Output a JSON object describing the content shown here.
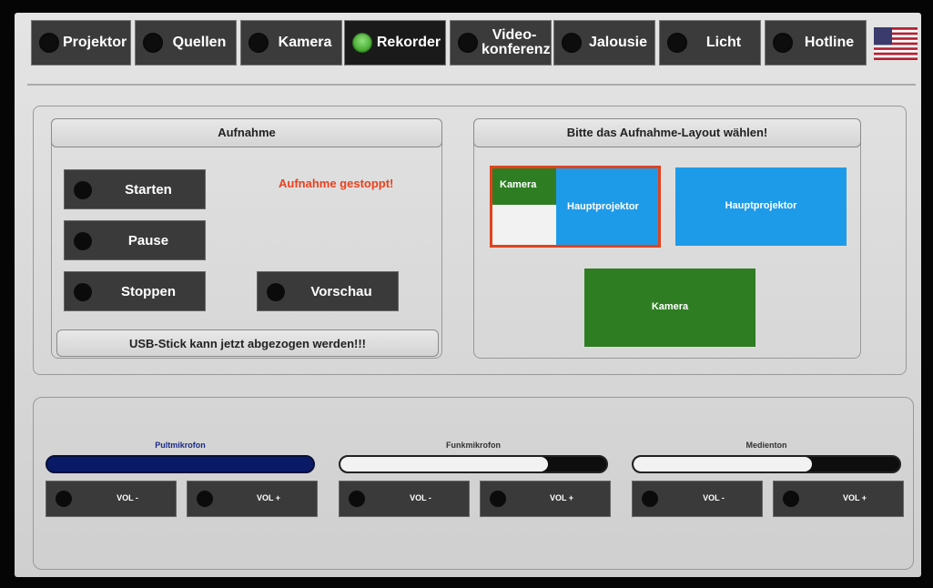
{
  "nav": {
    "tabs": [
      {
        "label": "Projektor",
        "active": false
      },
      {
        "label": "Quellen",
        "active": false
      },
      {
        "label": "Kamera",
        "active": false
      },
      {
        "label": "Rekorder",
        "active": true
      },
      {
        "label": "Video-\nkonferenz",
        "active": false
      },
      {
        "label": "Jalousie",
        "active": false
      },
      {
        "label": "Licht",
        "active": false
      },
      {
        "label": "Hotline",
        "active": false
      }
    ],
    "language_flag": "us-flag-icon"
  },
  "recording": {
    "title": "Aufnahme",
    "start_label": "Starten",
    "pause_label": "Pause",
    "stop_label": "Stoppen",
    "preview_label": "Vorschau",
    "status_text": "Aufnahme gestoppt!",
    "usb_message": "USB-Stick kann jetzt abgezogen werden!!!",
    "stop_active": true,
    "preview_active": true
  },
  "layout": {
    "title": "Bitte das Aufnahme-Layout wählen!",
    "option1": {
      "camera_label": "Kamera",
      "projector_label": "Hauptprojektor",
      "selected": true
    },
    "option2": {
      "projector_label": "Hauptprojektor"
    },
    "option3": {
      "camera_label": "Kamera"
    }
  },
  "audio": {
    "channels": [
      {
        "name": "Pultmikrofon",
        "level": 1.0,
        "vol_down": "VOL -",
        "vol_up": "VOL +"
      },
      {
        "name": "Funkmikrofon",
        "level": 0.78,
        "vol_down": "VOL -",
        "vol_up": "VOL +"
      },
      {
        "name": "Medienton",
        "level": 0.67,
        "vol_down": "VOL -",
        "vol_up": "VOL +"
      }
    ]
  },
  "colors": {
    "accent_green": "#2e7d22",
    "accent_blue": "#1e9be8",
    "status_red": "#e8411d",
    "selected_border": "#e0421c"
  }
}
